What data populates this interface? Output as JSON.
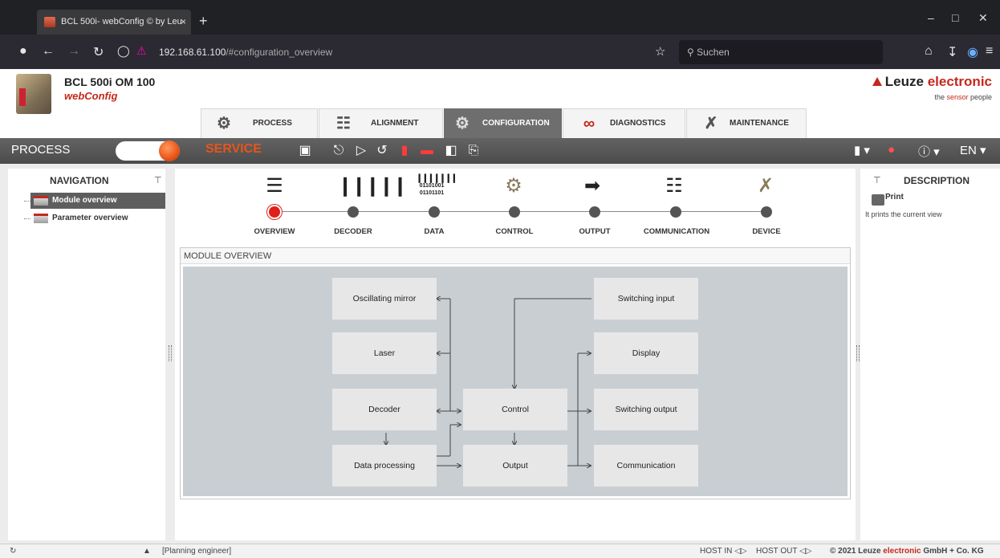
{
  "browser": {
    "tab_title": "BCL 500i- webConfig © by Leu",
    "tab_close": "×",
    "new_tab": "+",
    "url_host": "192.168.61.100",
    "url_path": "/#configuration_overview",
    "search_placeholder": "Suchen"
  },
  "header": {
    "device_name": "BCL 500i OM 100",
    "app_name": "webConfig",
    "brand": "Leuze electronic",
    "brand_plain": "Leuze ",
    "brand_red": "electronic",
    "slogan_pre": "the ",
    "slogan_red": "sensor",
    "slogan_post": " people"
  },
  "main_tabs": [
    {
      "label": "PROCESS"
    },
    {
      "label": "ALIGNMENT"
    },
    {
      "label": "CONFIGURATION",
      "active": true
    },
    {
      "label": "DIAGNOSTICS"
    },
    {
      "label": "MAINTENANCE"
    }
  ],
  "toolbar": {
    "process_label": "PROCESS",
    "service_label": "SERVICE",
    "language": "EN"
  },
  "navigation": {
    "title": "NAVIGATION",
    "items": [
      {
        "label": "Module overview",
        "selected": true
      },
      {
        "label": "Parameter overview"
      }
    ]
  },
  "steps": [
    {
      "label": "OVERVIEW",
      "active": true
    },
    {
      "label": "DECODER"
    },
    {
      "label": "DATA"
    },
    {
      "label": "CONTROL"
    },
    {
      "label": "OUTPUT"
    },
    {
      "label": "COMMUNICATION"
    },
    {
      "label": "DEVICE"
    }
  ],
  "data_icon_text": [
    "01101001",
    "01101101"
  ],
  "module_overview": {
    "title": "MODULE OVERVIEW",
    "blocks": {
      "oscillating_mirror": "Oscillating mirror",
      "laser": "Laser",
      "decoder": "Decoder",
      "data_processing": "Data processing",
      "control": "Control",
      "output": "Output",
      "switching_input": "Switching input",
      "display": "Display",
      "switching_output": "Switching output",
      "communication": "Communication"
    }
  },
  "description": {
    "title": "DESCRIPTION",
    "print_label": "Print",
    "print_desc": "It prints the current view"
  },
  "status": {
    "role": "[Planning engineer]",
    "host_in": "HOST IN",
    "host_out": "HOST OUT",
    "copyright_pre": "© 2021 Leuze ",
    "copyright_red": "electronic",
    "copyright_post": " GmbH + Co. KG"
  },
  "colors": {
    "brand_red": "#c5281c",
    "service_orange": "#e8541a",
    "active_step": "#e0201a",
    "toolbar_grey": "#555555"
  }
}
